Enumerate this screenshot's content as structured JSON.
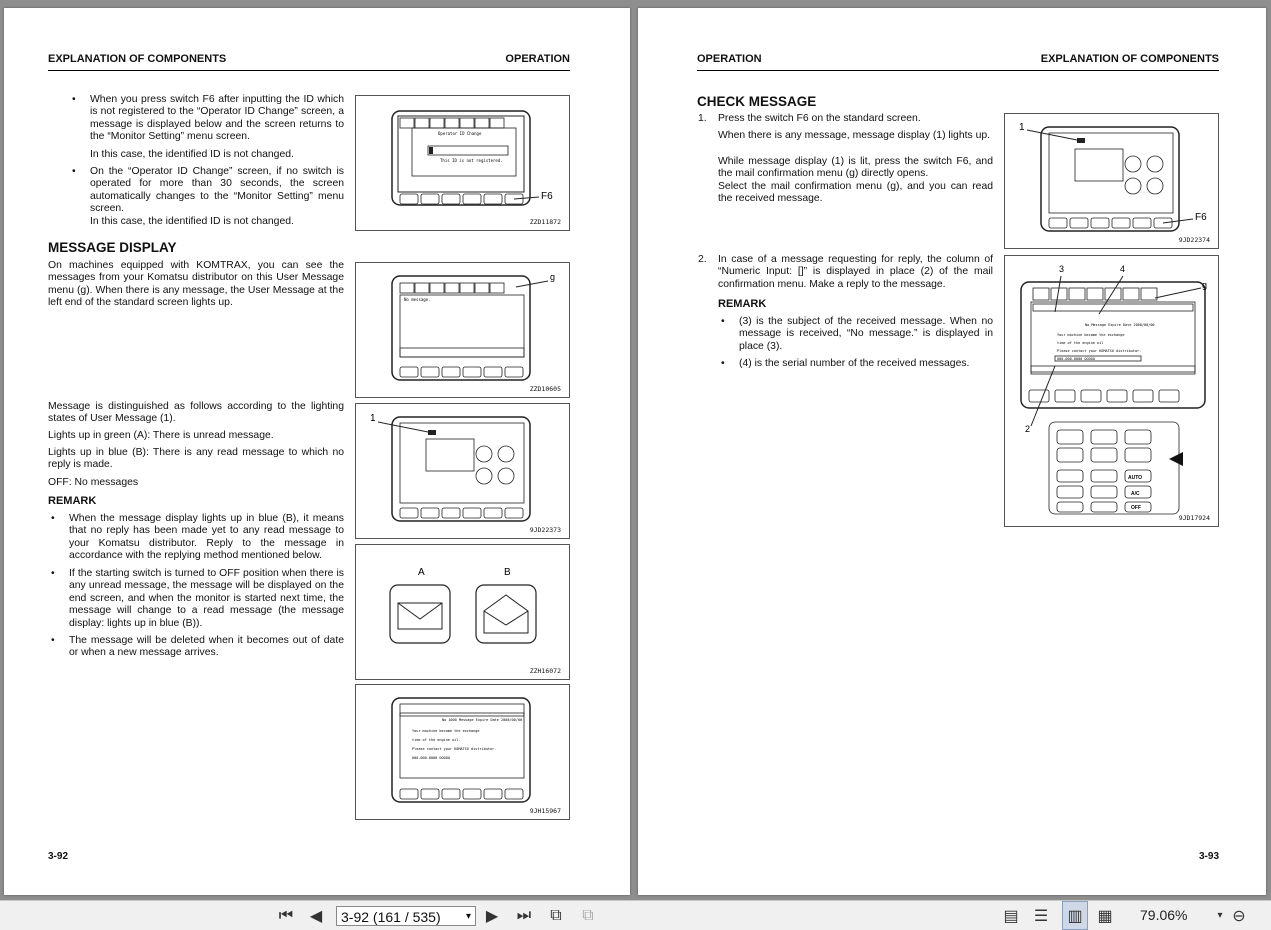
{
  "left_page": {
    "header_left": "EXPLANATION OF COMPONENTS",
    "header_right": "OPERATION",
    "bullets_top": [
      "When you press switch F6 after inputting the ID which is not registered to the “Operator ID Change” screen, a message is displayed below and the screen returns to the “Monitor Setting” menu screen.",
      "In this case, the identified ID is not changed.",
      "On the “Operator ID Change” screen, if no switch is operated for more than 30 seconds, the screen automatically changes to the “Monitor Setting” menu screen.",
      "In this case, the identified ID is not changed."
    ],
    "section_title": "MESSAGE DISPLAY",
    "intro": "On machines equipped with KOMTRAX, you can see the messages from your Komatsu distributor on this User Message menu (g). When there is any message, the User Message at the left end of the standard screen lights up.",
    "distinguish": "Message is distinguished as follows according to the lighting states of User Message (1).",
    "green": "Lights up in green (A): There is unread message.",
    "blue": "Lights up in blue (B): There is any read message to which no reply is made.",
    "off": "OFF: No messages",
    "remark_title": "REMARK",
    "remarks": [
      "When the message display lights up in blue (B), it means that no reply has been made yet to any read message to your Komatsu distributor. Reply to the message in accordance with the replying method mentioned below.",
      "If the starting switch is turned to OFF position when there is any unread message, the message will be displayed on the end screen, and when the monitor is started next time, the message will change to a read message (the message display: lights up in blue (B)).",
      "The message will be deleted when it becomes out of date or when a new message arrives."
    ],
    "page_number": "3-92",
    "figures": {
      "fig1": {
        "code": "ZZD11872",
        "label_f6": "F6",
        "screen_title": "Operator ID Change",
        "screen_msg": "This ID is not registered."
      },
      "fig2": {
        "code": "ZZD10605",
        "label_g": "g",
        "screen_msg": "No message."
      },
      "fig3": {
        "code": "9JD22373",
        "label_1": "1"
      },
      "fig4": {
        "code": "ZZH16072",
        "label_a": "A",
        "label_b": "B"
      },
      "fig5": {
        "code": "9JH15967",
        "line0": "No 1000 Message Expire Date 2008/00/00",
        "line1": "Your machine became the exchange",
        "line2": "time of the engine oil.",
        "line3": "Please contact your KOMATSU distributor.",
        "line4": "000-000-0000 OOOOO"
      }
    }
  },
  "right_page": {
    "header_left": "OPERATION",
    "header_right": "EXPLANATION OF COMPONENTS",
    "section_title": "CHECK MESSAGE",
    "step1_num": "1.",
    "step1": "Press the switch F6 on the standard screen.",
    "step1_p2": "When there is any message, message display (1) lights up.",
    "step1_p3": "While message display (1) is lit, press the switch F6, and the mail confirmation menu (g) directly opens.",
    "step1_p4": "Select the mail confirmation menu (g), and you can read the received message.",
    "step2_num": "2.",
    "step2": "In case of a message requesting for reply, the column of “Numeric Input: []” is displayed in place (2) of the mail confirmation menu. Make a reply to the message.",
    "remark_title": "REMARK",
    "remarks": [
      "(3) is the subject of the received message. When no message is received, “No message.” is displayed in place (3).",
      "(4) is the serial number of the received messages."
    ],
    "page_number": "3-93",
    "figures": {
      "fig1": {
        "code": "9JD22374",
        "label_1": "1",
        "label_f6": "F6"
      },
      "fig2": {
        "code": "9JD17924",
        "label_3": "3",
        "label_4": "4",
        "label_g": "g",
        "label_2": "2",
        "line0": "No Message Expire Date 2008/00/00",
        "line1": "Your machine became the exchange",
        "line2": "time of the engine oil",
        "line3": "Please contact your KOMATSU distributor.",
        "line4": "000-000-0000 OOOOO",
        "auto": "AUTO",
        "ac": "A/C",
        "off": "OFF"
      }
    }
  },
  "toolbar": {
    "page_field": "3-92 (161 / 535)",
    "zoom": "79.06%",
    "icons": [
      "first-page-icon",
      "prev-page-icon",
      "next-page-icon",
      "last-page-icon",
      "rotate-icon",
      "thumbnails-icon",
      "single-page-icon",
      "continuous-icon",
      "two-page-icon",
      "two-page-continuous-icon",
      "zoom-dropdown-icon",
      "zoom-out-icon"
    ]
  }
}
